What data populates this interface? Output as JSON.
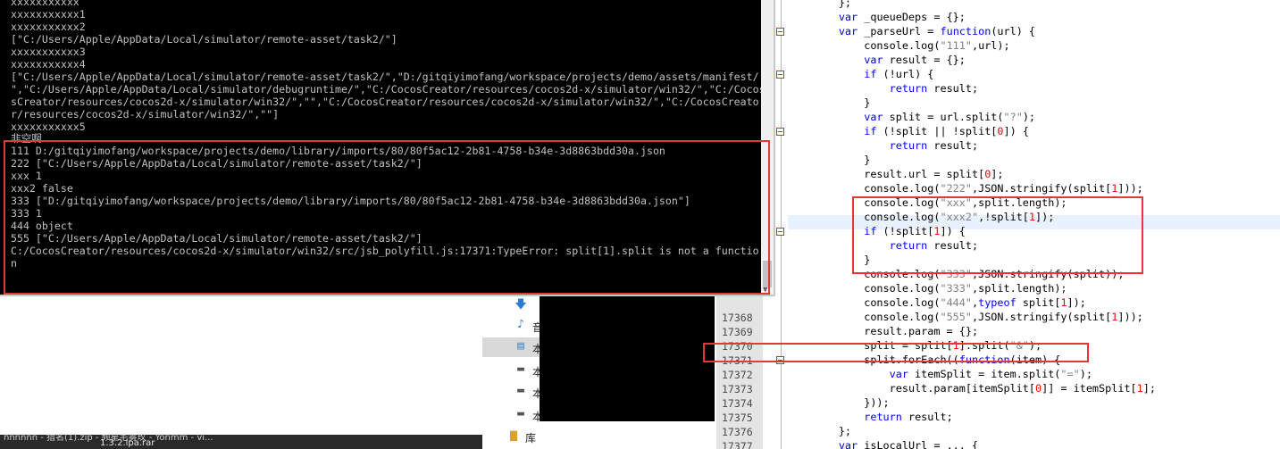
{
  "console": {
    "lines": [
      "xxxxxxxxxxx",
      "xxxxxxxxxxx1",
      "xxxxxxxxxxx2",
      "[\"C:/Users/Apple/AppData/Local/simulator/remote-asset/task2/\"]",
      "xxxxxxxxxxx3",
      "xxxxxxxxxxx4",
      "[\"C:/Users/Apple/AppData/Local/simulator/remote-asset/task2/\",\"D:/gitqiyimofang/workspace/projects/demo/assets/manifest/",
      "\",\"C:/Users/Apple/AppData/Local/simulator/debugruntime/\",\"C:/CocosCreator/resources/cocos2d-x/simulator/win32/\",\"C:/Cocos",
      "sCreator/resources/cocos2d-x/simulator/win32/\",\"\",\"C:/CocosCreator/resources/cocos2d-x/simulator/win32/\",\"C:/CocosCreato",
      "r/resources/cocos2d-x/simulator/win32/\",\"\"]",
      "xxxxxxxxxxx5",
      "非空啊",
      "111 D:/gitqiyimofang/workspace/projects/demo/library/imports/80/80f5ac12-2b81-4758-b34e-3d8863bdd30a.json",
      "222 [\"C:/Users/Apple/AppData/Local/simulator/remote-asset/task2/\"]",
      "xxx 1",
      "xxx2 false",
      "333 [\"D:/gitqiyimofang/workspace/projects/demo/library/imports/80/80f5ac12-2b81-4758-b34e-3d8863bdd30a.json\"]",
      "333 1",
      "444 object",
      "555 [\"C:/Users/Apple/AppData/Local/simulator/remote-asset/task2/\"]",
      "C:/CocosCreator/resources/cocos2d-x/simulator/win32/src/jsb_polyfill.js:17371:TypeError: split[1].split is not a functio",
      "n"
    ]
  },
  "explorer": {
    "items": [
      {
        "icon": "download-icon",
        "label": ""
      },
      {
        "icon": "music-icon",
        "label": "音"
      },
      {
        "icon": "computer-icon",
        "label": "本"
      },
      {
        "icon": "drive-icon",
        "label": "本"
      },
      {
        "icon": "drive-icon",
        "label": "本"
      },
      {
        "icon": "drive-icon",
        "label": "本"
      },
      {
        "icon": "library-icon",
        "label": "库"
      }
    ]
  },
  "desktop": {
    "label_top": "nnnnnn - 猎名(1).zip - 频星宅雾玫 - Yonmm - vi...",
    "label_file": "1.3.2.ipa.rar"
  },
  "editor": {
    "line_numbers": [
      "17368",
      "17369",
      "17370",
      "17371",
      "17372",
      "17373",
      "17374",
      "17375",
      "17376",
      "17377"
    ],
    "code": [
      [
        [
          "p",
          "        };"
        ]
      ],
      [
        [
          "p",
          "        "
        ],
        [
          "k",
          "var"
        ],
        [
          "p",
          " _queueDeps = {};"
        ]
      ],
      [
        [
          "p",
          "        "
        ],
        [
          "k",
          "var"
        ],
        [
          "p",
          " _parseUrl = "
        ],
        [
          "k",
          "function"
        ],
        [
          "p",
          "(url) {"
        ]
      ],
      [
        [
          "p",
          "            console.log("
        ],
        [
          "s",
          "\"111\""
        ],
        [
          "p",
          ",url);"
        ]
      ],
      [
        [
          "p",
          "            "
        ],
        [
          "k",
          "var"
        ],
        [
          "p",
          " result = {};"
        ]
      ],
      [
        [
          "p",
          "            "
        ],
        [
          "k",
          "if"
        ],
        [
          "p",
          " (!url) {"
        ]
      ],
      [
        [
          "p",
          "                "
        ],
        [
          "k",
          "return"
        ],
        [
          "p",
          " result;"
        ]
      ],
      [
        [
          "p",
          "            }"
        ]
      ],
      [
        [
          "p",
          "            "
        ],
        [
          "k",
          "var"
        ],
        [
          "p",
          " split = url.split("
        ],
        [
          "s",
          "\"?\""
        ],
        [
          "p",
          ");"
        ]
      ],
      [
        [
          "p",
          "            "
        ],
        [
          "k",
          "if"
        ],
        [
          "p",
          " (!split || !split["
        ],
        [
          "n",
          "0"
        ],
        [
          "p",
          "]) {"
        ]
      ],
      [
        [
          "p",
          "                "
        ],
        [
          "k",
          "return"
        ],
        [
          "p",
          " result;"
        ]
      ],
      [
        [
          "p",
          "            }"
        ]
      ],
      [
        [
          "p",
          "            result.url = split["
        ],
        [
          "n",
          "0"
        ],
        [
          "p",
          "];"
        ]
      ],
      [
        [
          "p",
          "            console.log("
        ],
        [
          "s",
          "\"222\""
        ],
        [
          "p",
          ",JSON.stringify(split["
        ],
        [
          "n",
          "1"
        ],
        [
          "p",
          "]));"
        ]
      ],
      [
        [
          "p",
          "            console.log("
        ],
        [
          "s",
          "\"xxx\""
        ],
        [
          "p",
          ",split.length);"
        ]
      ],
      [
        [
          "p",
          "            console.log("
        ],
        [
          "s",
          "\"xxx2\""
        ],
        [
          "p",
          ",!split["
        ],
        [
          "n",
          "1"
        ],
        [
          "p",
          "]);"
        ]
      ],
      [
        [
          "p",
          "            "
        ],
        [
          "k",
          "if"
        ],
        [
          "p",
          " (!split["
        ],
        [
          "n",
          "1"
        ],
        [
          "p",
          "]) {"
        ]
      ],
      [
        [
          "p",
          "                "
        ],
        [
          "k",
          "return"
        ],
        [
          "p",
          " result;"
        ]
      ],
      [
        [
          "p",
          "            }"
        ]
      ],
      [
        [
          "p",
          "            console.log("
        ],
        [
          "s",
          "\"333\""
        ],
        [
          "p",
          ",JSON.stringify(split));"
        ]
      ],
      [
        [
          "p",
          "            console.log("
        ],
        [
          "s",
          "\"333\""
        ],
        [
          "p",
          ",split.length);"
        ]
      ],
      [
        [
          "p",
          "            console.log("
        ],
        [
          "s",
          "\"444\""
        ],
        [
          "p",
          ","
        ],
        [
          "k",
          "typeof"
        ],
        [
          "p",
          " split["
        ],
        [
          "n",
          "1"
        ],
        [
          "p",
          "]);"
        ]
      ],
      [
        [
          "p",
          "            console.log("
        ],
        [
          "s",
          "\"555\""
        ],
        [
          "p",
          ",JSON.stringify(split["
        ],
        [
          "n",
          "1"
        ],
        [
          "p",
          "]));"
        ]
      ],
      [
        [
          "p",
          "            result.param = {};"
        ]
      ],
      [
        [
          "p",
          "            split = split["
        ],
        [
          "n",
          "1"
        ],
        [
          "p",
          "].split("
        ],
        [
          "s",
          "\"&\""
        ],
        [
          "p",
          ");"
        ]
      ],
      [
        [
          "p",
          "            split.forEach(("
        ],
        [
          "k",
          "function"
        ],
        [
          "p",
          "(item) {"
        ]
      ],
      [
        [
          "p",
          "                "
        ],
        [
          "k",
          "var"
        ],
        [
          "p",
          " itemSplit = item.split("
        ],
        [
          "s",
          "\"=\""
        ],
        [
          "p",
          ");"
        ]
      ],
      [
        [
          "p",
          "                result.param[itemSplit["
        ],
        [
          "n",
          "0"
        ],
        [
          "p",
          "]] = itemSplit["
        ],
        [
          "n",
          "1"
        ],
        [
          "p",
          "];"
        ]
      ],
      [
        [
          "p",
          "            }));"
        ]
      ],
      [
        [
          "p",
          "            "
        ],
        [
          "k",
          "return"
        ],
        [
          "p",
          " result;"
        ]
      ],
      [
        [
          "p",
          "        };"
        ]
      ],
      [
        [
          "p",
          "        "
        ],
        [
          "k",
          "var"
        ],
        [
          "p",
          " isLocalUrl = ... {"
        ]
      ]
    ]
  },
  "colors": {
    "console_bg": "#000000",
    "console_text": "#c0c0c0",
    "keyword": "#0000ff",
    "string": "#808080",
    "number": "#ff0000",
    "annotation_red": "#e43838"
  }
}
